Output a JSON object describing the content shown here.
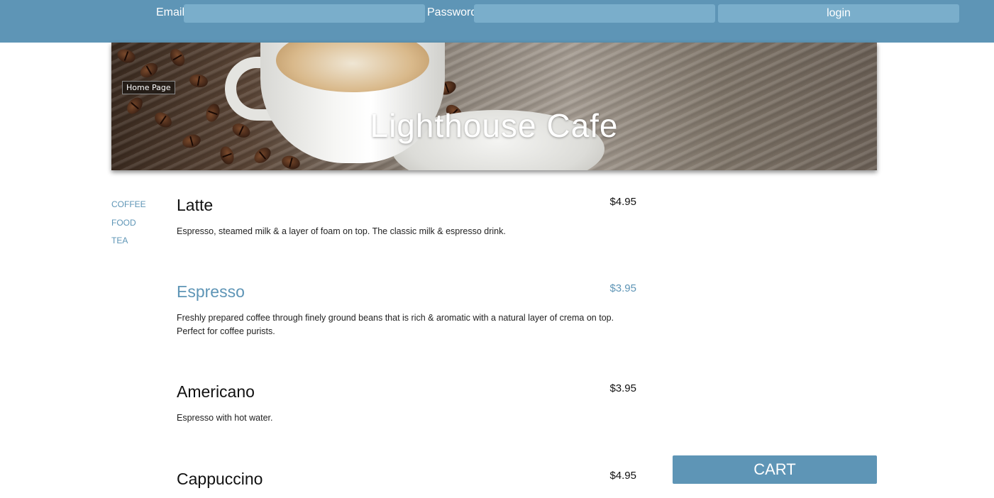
{
  "login": {
    "email_label": "Email",
    "email_value": "",
    "password_label": "Password",
    "password_value": "",
    "login_label": "login"
  },
  "hero": {
    "home_badge": "Home Page",
    "title": "Lighthouse Cafe"
  },
  "categories": [
    "COFFEE",
    "FOOD",
    "TEA"
  ],
  "menu": [
    {
      "name": "Latte",
      "price": "$4.95",
      "description": "Espresso, steamed milk & a layer of foam on top. The classic milk & espresso drink."
    },
    {
      "name": "Espresso",
      "price": "$3.95",
      "description": "Freshly prepared coffee through finely ground beans that is rich & aromatic with a natural layer of crema on top. Perfect for coffee purists."
    },
    {
      "name": "Americano",
      "price": "$3.95",
      "description": "Espresso with hot water."
    },
    {
      "name": "Cappuccino",
      "price": "$4.95",
      "description": ""
    }
  ],
  "cart": {
    "label": "CART"
  },
  "colors": {
    "accent": "#5e95b6",
    "field": "#7aaecb"
  }
}
